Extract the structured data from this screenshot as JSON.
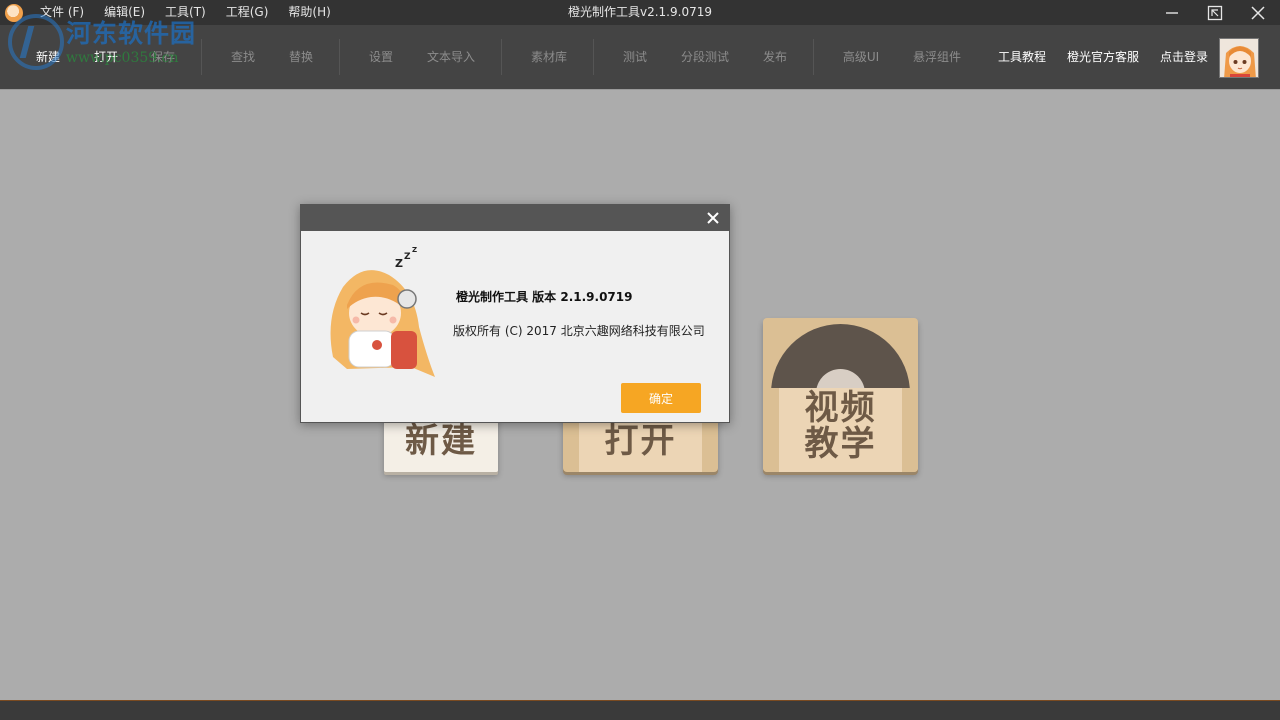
{
  "window": {
    "title": "橙光制作工具v2.1.9.0719"
  },
  "menu": [
    {
      "label": "文件 (F)"
    },
    {
      "label": "编辑(E)"
    },
    {
      "label": "工具(T)"
    },
    {
      "label": "工程(G)"
    },
    {
      "label": "帮助(H)"
    }
  ],
  "watermark": {
    "title": "河东软件园",
    "url": "www.pc0359.cn"
  },
  "toolbar": {
    "new": "新建",
    "open": "打开",
    "save": "保存",
    "find": "查找",
    "replace": "替换",
    "settings": "设置",
    "text_import": "文本导入",
    "asset_library": "素材库",
    "test": "测试",
    "segment_test": "分段测试",
    "publish": "发布",
    "advanced_ui": "高级UI",
    "floating_widget": "悬浮组件",
    "tutorial": "工具教程",
    "support": "橙光官方客服",
    "login": "点击登录"
  },
  "tiles": {
    "new": "新建",
    "open": "打开",
    "video_line1": "视频",
    "video_line2": "教学"
  },
  "dialog": {
    "product": "橙光制作工具 版本 2.1.9.0719",
    "copyright": "版权所有 (C) 2017 北京六趣网络科技有限公司",
    "ok": "确定"
  },
  "colors": {
    "accent": "#f6a623",
    "toolbar_bg": "#444444",
    "titlebar_bg": "#333333",
    "workspace_bg": "#acacac"
  }
}
